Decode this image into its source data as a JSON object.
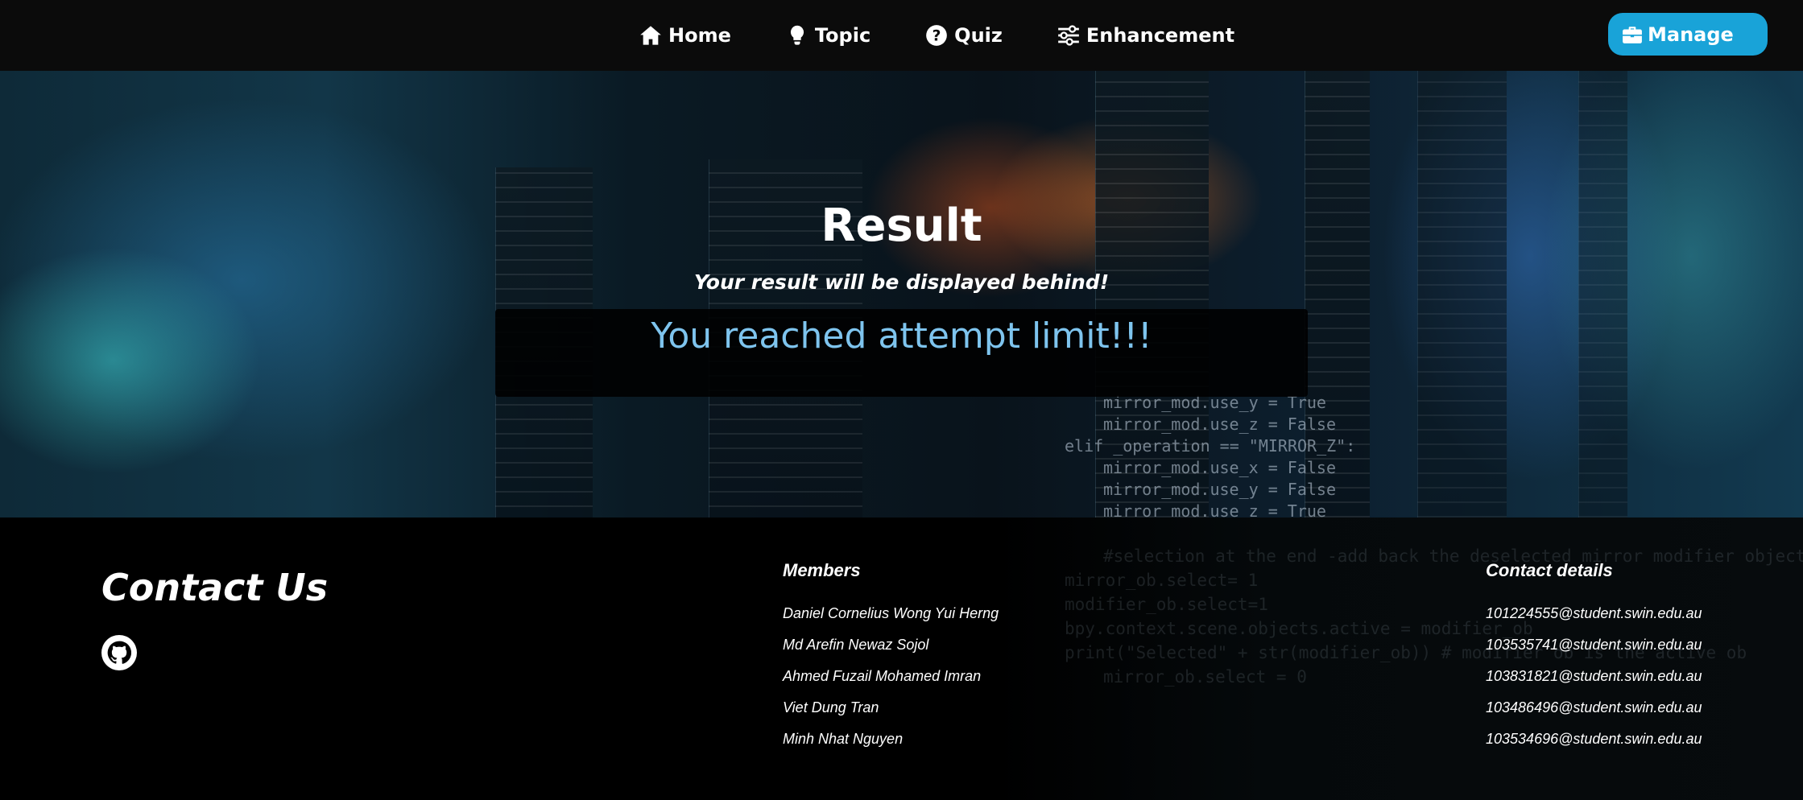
{
  "nav": {
    "items": [
      {
        "label": "Home",
        "icon": "home-icon"
      },
      {
        "label": "Topic",
        "icon": "lightbulb-icon"
      },
      {
        "label": "Quiz",
        "icon": "question-circle-icon"
      },
      {
        "label": "Enhancement",
        "icon": "sliders-icon"
      }
    ],
    "manage": {
      "label": "Manage",
      "icon": "toolbox-icon"
    }
  },
  "hero": {
    "title": "Result",
    "subtitle": "Your result will be displayed behind!",
    "message": "You reached attempt limit!!!",
    "background_code": [
      "mirror_mod.use_y = True",
      "mirror_mod.use_z = False",
      "elif _operation == \"MIRROR_Z\":",
      "mirror_mod.use_x = False",
      "mirror_mod.use_y = False",
      "mirror_mod.use_z = True"
    ]
  },
  "footer": {
    "contact_title": "Contact Us",
    "github_icon": "github-icon",
    "members_heading": "Members",
    "members": [
      "Daniel Cornelius Wong Yui Herng",
      "Md Arefin Newaz Sojol",
      "Ahmed Fuzail Mohamed Imran",
      "Viet Dung Tran",
      "Minh Nhat Nguyen"
    ],
    "contact_heading": "Contact details",
    "emails": [
      "101224555@student.swin.edu.au",
      "103535741@student.swin.edu.au",
      "103831821@student.swin.edu.au",
      "103486496@student.swin.edu.au",
      "103534696@student.swin.edu.au"
    ],
    "background_code": [
      "#selection at the end -add back the deselected mirror modifier object",
      "mirror_ob.select= 1",
      "modifier_ob.select=1",
      "bpy.context.scene.objects.active = modifier_ob",
      "print(\"Selected\" + str(modifier_ob)) # modifier ob is the active ob",
      "mirror_ob.select = 0"
    ]
  },
  "colors": {
    "accent": "#19a3d8",
    "message": "#7ec4ee",
    "navbar": "#0b0b0b"
  }
}
